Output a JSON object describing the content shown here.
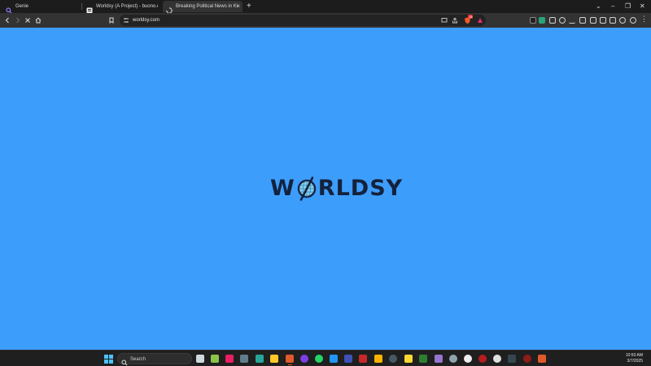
{
  "browser": {
    "tabs": [
      {
        "title": "Genie",
        "active": false
      },
      {
        "title": "Worldsy (A Project) - buono.email",
        "active": false
      },
      {
        "title": "Breaking Political News in Kings",
        "active": true
      }
    ],
    "address": "worldsy.com",
    "extension_badge": "18"
  },
  "page": {
    "logo_left": "W",
    "logo_right": "RLDSY",
    "background": "#3d9dfb"
  },
  "taskbar": {
    "search_placeholder": "Search",
    "time": "10:50 AM",
    "date": "3/7/2025"
  },
  "colors": {
    "accent_blue": "#3d9dfb",
    "logo_navy": "#14223d",
    "chrome_dark": "#333333"
  }
}
